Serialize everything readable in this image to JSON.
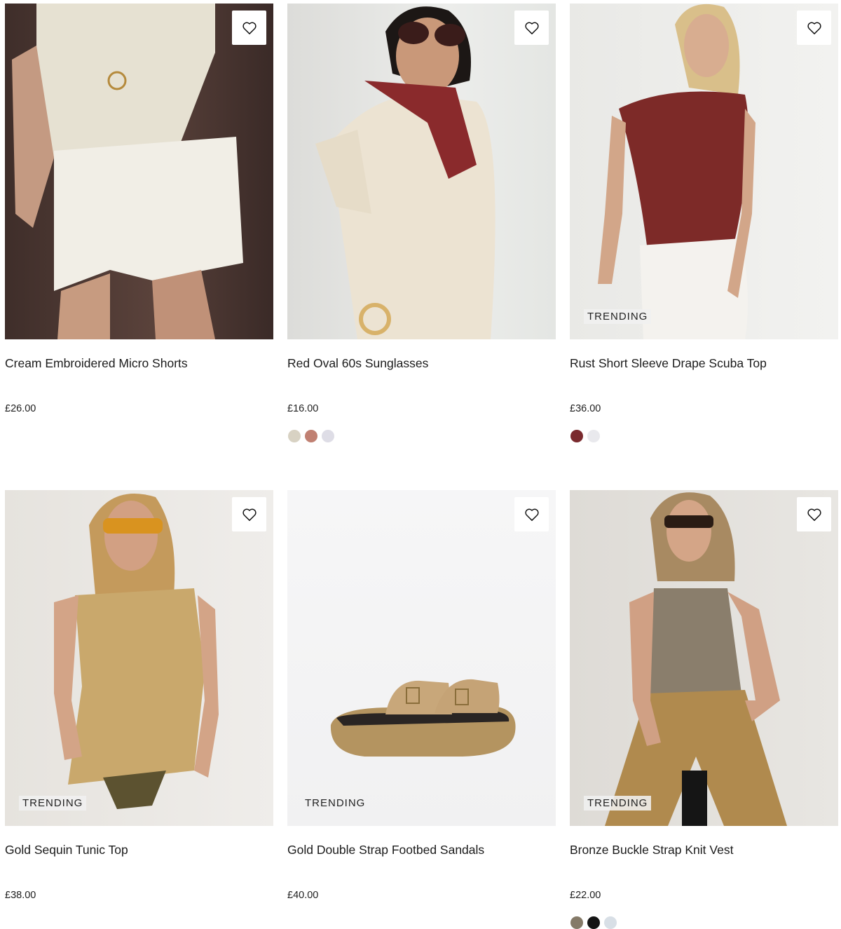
{
  "products": [
    {
      "name": "Cream Embroidered Micro Shorts",
      "price": "£26.00",
      "badge": "",
      "wishlist_icon": "heart-outline-icon",
      "swatches": []
    },
    {
      "name": "Red Oval 60s Sunglasses",
      "price": "£16.00",
      "badge": "",
      "wishlist_icon": "heart-outline-icon",
      "swatches": [
        "#d8d2c3",
        "#c08072",
        "#dedde6"
      ]
    },
    {
      "name": "Rust Short Sleeve Drape Scuba Top",
      "price": "£36.00",
      "badge": "TRENDING",
      "wishlist_icon": "heart-outline-icon",
      "swatches": [
        "#7a2a2e",
        "#e9e9ed"
      ]
    },
    {
      "name": "Gold Sequin Tunic Top",
      "price": "£38.00",
      "badge": "TRENDING",
      "wishlist_icon": "heart-outline-icon",
      "swatches": []
    },
    {
      "name": "Gold Double Strap Footbed Sandals",
      "price": "£40.00",
      "badge": "TRENDING",
      "wishlist_icon": "heart-outline-icon",
      "swatches": []
    },
    {
      "name": "Bronze Buckle Strap Knit Vest",
      "price": "£22.00",
      "badge": "TRENDING",
      "wishlist_icon": "heart-outline-icon",
      "swatches": [
        "#857a68",
        "#141414",
        "#d8dfe6"
      ]
    }
  ]
}
